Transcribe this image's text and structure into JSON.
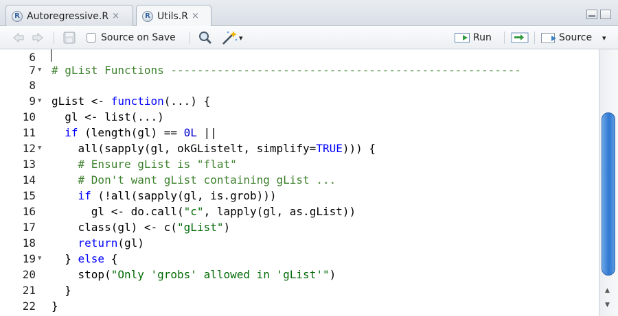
{
  "tabs": [
    {
      "label": "Autoregressive.R",
      "close": "×",
      "active": false
    },
    {
      "label": "Utils.R",
      "close": "×",
      "active": true
    }
  ],
  "toolbar": {
    "source_on_save_label": "Source on Save",
    "source_on_save_checked": false,
    "run_label": "Run",
    "source_label": "Source",
    "dropdown_glyph": "▾"
  },
  "editor": {
    "lines": [
      {
        "n": "6",
        "fold": false
      },
      {
        "n": "7",
        "fold": true
      },
      {
        "n": "8",
        "fold": false
      },
      {
        "n": "9",
        "fold": true
      },
      {
        "n": "10",
        "fold": false
      },
      {
        "n": "11",
        "fold": false
      },
      {
        "n": "12",
        "fold": true
      },
      {
        "n": "13",
        "fold": false
      },
      {
        "n": "14",
        "fold": false
      },
      {
        "n": "15",
        "fold": false
      },
      {
        "n": "16",
        "fold": false
      },
      {
        "n": "17",
        "fold": false
      },
      {
        "n": "18",
        "fold": false
      },
      {
        "n": "19",
        "fold": true
      },
      {
        "n": "20",
        "fold": false
      },
      {
        "n": "21",
        "fold": false
      },
      {
        "n": "22",
        "fold": false
      }
    ],
    "tokens": {
      "l7_comment": "# gList Functions -----------------------------------------------------",
      "l9_a": "gList <- ",
      "l9_kw": "function",
      "l9_b": "(...) {",
      "l10": "  gl <- list(...)",
      "l11_kw": "if",
      "l11_a": " (length(gl) == ",
      "l11_num": "0L",
      "l11_b": " ||",
      "l12_a": "    all(sapply(gl, okGListelt, simplify=",
      "l12_kw": "TRUE",
      "l12_b": "))) {",
      "l13_comment": "# Ensure gList is \"flat\"",
      "l14_comment": "# Don't want gList containing gList ...",
      "l15_kw": "if",
      "l15_a": " (!all(sapply(gl, is.grob)))",
      "l16_a": "      gl <- do.call(",
      "l16_str": "\"c\"",
      "l16_b": ", lapply(gl, as.gList))",
      "l17_a": "    class(gl) <- c(",
      "l17_str": "\"gList\"",
      "l17_b": ")",
      "l18_kw": "return",
      "l18_a": "(gl)",
      "l19_a": "  } ",
      "l19_kw": "else",
      "l19_b": " {",
      "l20_a": "    stop(",
      "l20_str": "\"Only 'grobs' allowed in 'gList'\"",
      "l20_b": ")",
      "l21": "  }",
      "l22": "}"
    }
  },
  "colors": {
    "comment": "#3c802c",
    "keyword": "#0000ff",
    "string": "#036a07",
    "number": "#0000cd",
    "scrollbar_thumb": "#2f77d0"
  },
  "scrollbar": {
    "up_glyph": "▲",
    "down_glyph": "▼"
  }
}
